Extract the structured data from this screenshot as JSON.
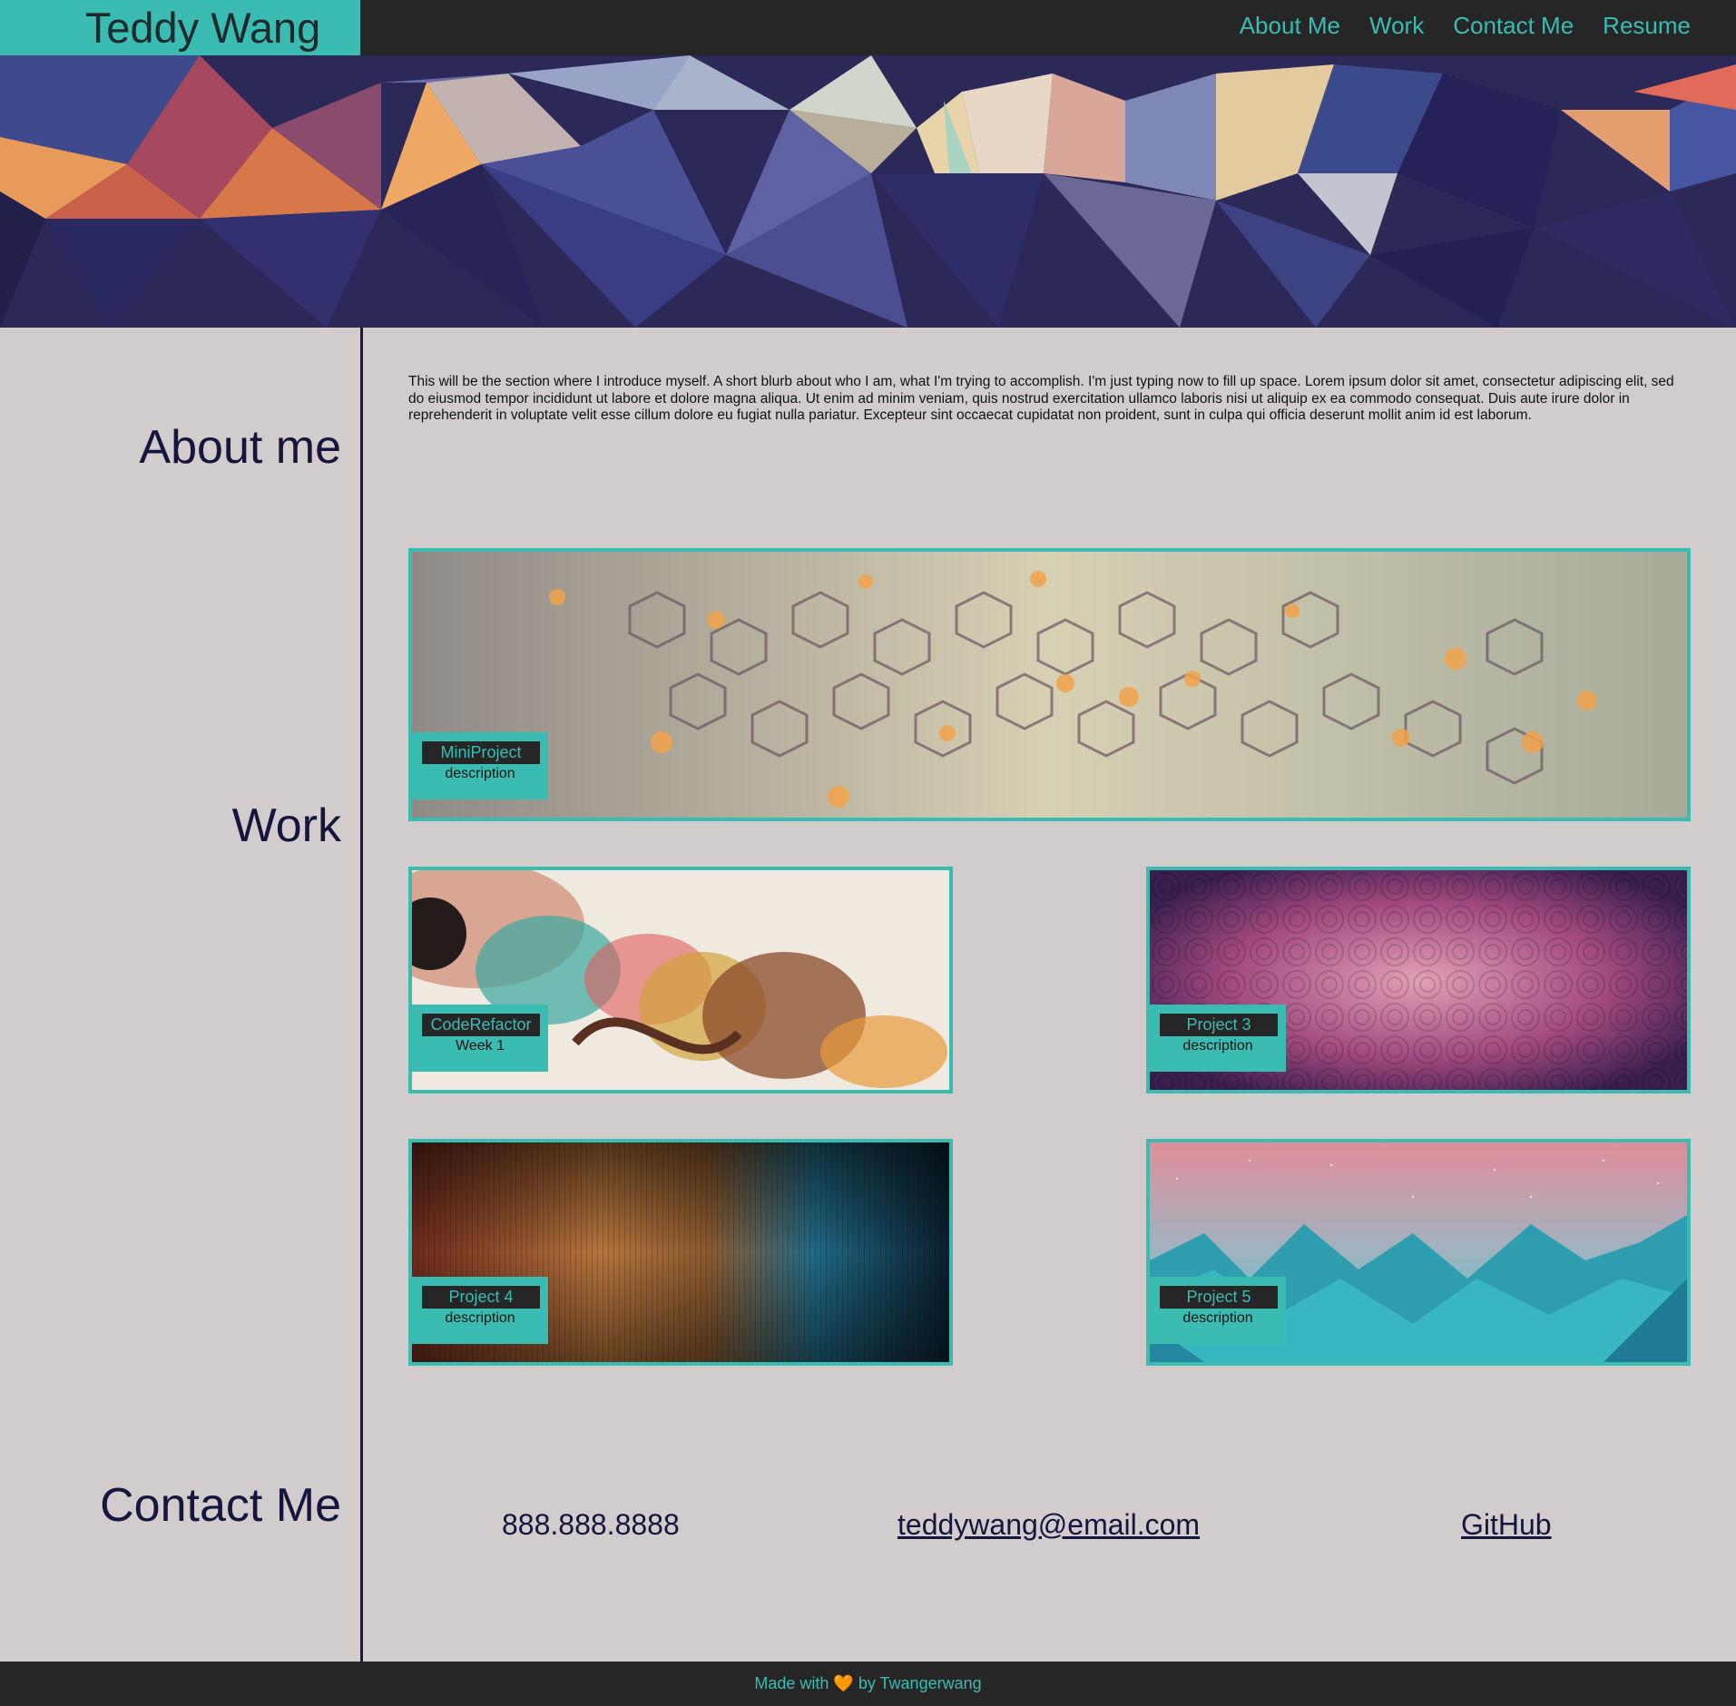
{
  "header": {
    "brand": "Teddy Wang",
    "nav": [
      "About Me",
      "Work",
      "Contact Me",
      "Resume"
    ]
  },
  "sections": {
    "about": "About me",
    "work": "Work",
    "contact": "Contact Me"
  },
  "about": {
    "text": "This will be the section where I introduce myself. A short blurb about who I am, what I'm trying to accomplish. I'm just typing now to fill up space. Lorem ipsum dolor sit amet, consectetur adipiscing elit, sed do eiusmod tempor incididunt ut labore et dolore magna aliqua. Ut enim ad minim veniam, quis nostrud exercitation ullamco laboris nisi ut aliquip ex ea commodo consequat. Duis aute irure dolor in reprehenderit in voluptate velit esse cillum dolore eu fugiat nulla pariatur. Excepteur sint occaecat cupidatat non proident, sunt in culpa qui officia deserunt mollit anim id est laborum."
  },
  "projects": [
    {
      "title": "MiniProject",
      "desc": "description"
    },
    {
      "title": "CodeRefactor",
      "desc": "Week 1"
    },
    {
      "title": "Project 3",
      "desc": "description"
    },
    {
      "title": "Project 4",
      "desc": "description"
    },
    {
      "title": "Project 5",
      "desc": "description"
    }
  ],
  "contact": {
    "phone": "888.888.8888",
    "email": "teddywang@email.com",
    "github": "GitHub"
  },
  "footer": {
    "prefix": "Made with",
    "heart": "🧡",
    "suffix": "by Twangerwang"
  },
  "colors": {
    "accent": "#3bbcb3",
    "dark": "#262626",
    "background": "#d2cccd",
    "heading": "#16153d"
  }
}
